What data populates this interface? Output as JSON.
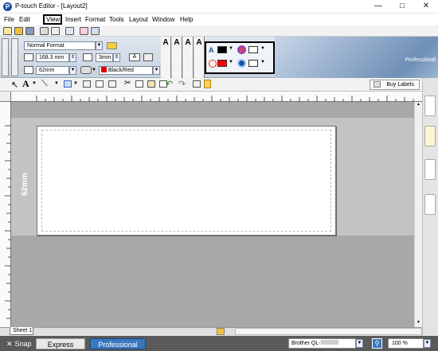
{
  "window": {
    "title": "P-touch Editor - [Layout2]",
    "app_icon": "P"
  },
  "menu": [
    "File",
    "Edit",
    "View",
    "Insert",
    "Format",
    "Tools",
    "Layout",
    "Window",
    "Help"
  ],
  "property": {
    "format": "Normal Format",
    "length": "168.3 mm",
    "margin": "3mm",
    "tape_width": "62mm",
    "color_mode": "Black/Red",
    "align_icon": "A"
  },
  "toolbar": {
    "buy_labels": "Buy Labels"
  },
  "branding": {
    "professional": "Professional"
  },
  "canvas": {
    "tape_label": "62mm"
  },
  "sheet": {
    "tab": "Sheet 1"
  },
  "status": {
    "snap": "Snap",
    "express": "Express",
    "professional": "Professional",
    "printer": "Brother QL-",
    "zoom": "100 %"
  },
  "colors": {
    "accent": "#1b4fa0",
    "text_color": "#000000",
    "fill_color": "#ff0000"
  }
}
